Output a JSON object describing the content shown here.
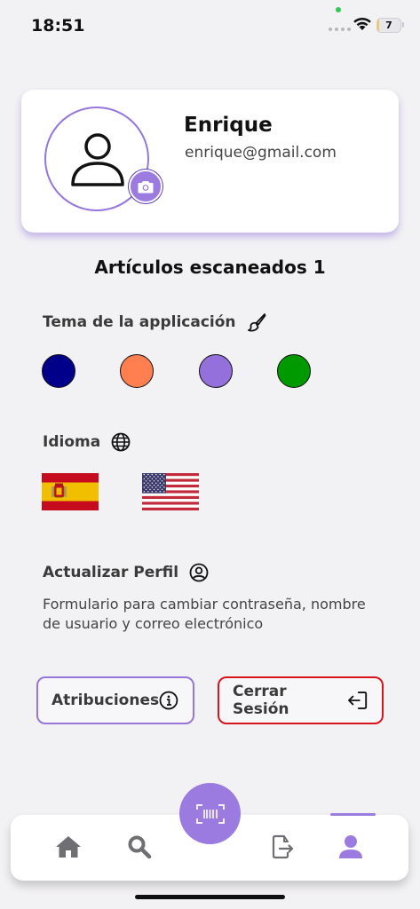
{
  "status_bar": {
    "time": "18:51",
    "battery": "7",
    "battery_level": 0.07
  },
  "profile": {
    "name": "Enrique",
    "email": "enrique@gmail.com"
  },
  "scanned": {
    "text": "Artículos escaneados 1"
  },
  "theme": {
    "title": "Tema de la applicación",
    "colors": [
      "#00008b",
      "#ff7f50",
      "#9370db",
      "#009900"
    ]
  },
  "language": {
    "title": "Idioma",
    "options": [
      "spain-flag",
      "usa-flag"
    ]
  },
  "update_profile": {
    "title": "Actualizar Perfil",
    "description": "Formulario para cambiar contraseña, nombre de usuario y correo electrónico"
  },
  "actions": {
    "attributions": "Atribuciones",
    "logout": "Cerrar Sesión"
  },
  "nav": {
    "items": [
      "home-icon",
      "search-icon",
      "barcode-scan-icon",
      "file-export-icon",
      "user-icon"
    ],
    "active": "user-icon",
    "accent": "#9b7be0"
  },
  "colors": {
    "accent": "#9b7be0",
    "danger": "#d8141d",
    "background": "#f2f1f3"
  }
}
